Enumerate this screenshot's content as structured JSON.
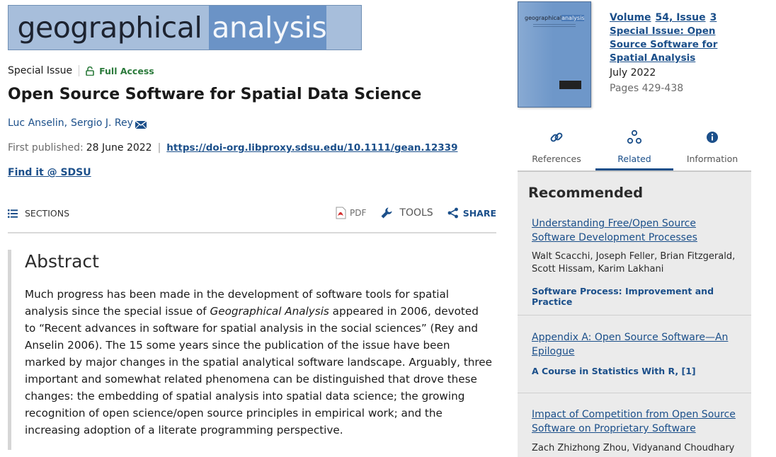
{
  "journal": {
    "name_part1": "geographical",
    "name_part2": "analysis"
  },
  "article": {
    "type": "Special Issue",
    "access": "Full Access",
    "title": "Open Source Software for Spatial Data Science",
    "authors": [
      "Luc Anselin,",
      "Sergio J. Rey"
    ],
    "first_published_label": "First published:",
    "first_published_date": "28 June 2022",
    "doi": "https://doi-org.libproxy.sdsu.edu/10.1111/gean.12339",
    "find_it": "Find it @ SDSU"
  },
  "toolbar": {
    "sections": "SECTIONS",
    "pdf": "PDF",
    "tools": "TOOLS",
    "share": "SHARE"
  },
  "abstract": {
    "heading": "Abstract",
    "text_before": "Much progress has been made in the development of software tools for spatial analysis since the special issue of ",
    "text_italic": "Geographical Analysis",
    "text_after": " appeared in 2006, devoted to “Recent advances in software for spatial analysis in the social sciences” (Rey and Anselin 2006). The 15 some years since the publication of the issue have been marked by major changes in the spatial analytical software landscape. Arguably, three important and somewhat related phenomena can be distinguished that drove these changes: the embedding of spatial analysis into spatial data science; the growing recognition of open science/open source principles in empirical work; and the increasing adoption of a literate programming perspective."
  },
  "issue": {
    "cover_title_a": "geographical",
    "cover_title_b": "analysis",
    "volume": "Volume",
    "volume_no": "54, Issue",
    "issue_no": "3",
    "special_issue": "Special Issue: Open Source Software for Spatial Analysis",
    "month": "July 2022",
    "pages": "Pages 429-438"
  },
  "tabs": [
    {
      "label": "References",
      "icon": "link-icon"
    },
    {
      "label": "Related",
      "icon": "related-icon"
    },
    {
      "label": "Information",
      "icon": "info-icon"
    }
  ],
  "recommended": {
    "heading": "Recommended",
    "items": [
      {
        "title": "Understanding Free/Open Source Software Development Processes",
        "authors": "Walt Scacchi, Joseph Feller, Brian Fitzgerald, Scott Hissam, Karim Lakhani",
        "journal": "Software Process: Improvement and Practice"
      },
      {
        "title": "Appendix A: Open Source Software—An Epilogue",
        "authors": "",
        "journal": "A Course in Statistics With R, [1]"
      },
      {
        "title": "Impact of Competition from Open Source Software on Proprietary Software",
        "authors": "Zach Zhizhong Zhou, Vidyanand Choudhary",
        "journal": ""
      }
    ]
  },
  "colors": {
    "link": "#1b4f8a",
    "access": "#2b7a3b",
    "banner_light": "#a7bedb",
    "banner_dark": "#6b93c6"
  }
}
